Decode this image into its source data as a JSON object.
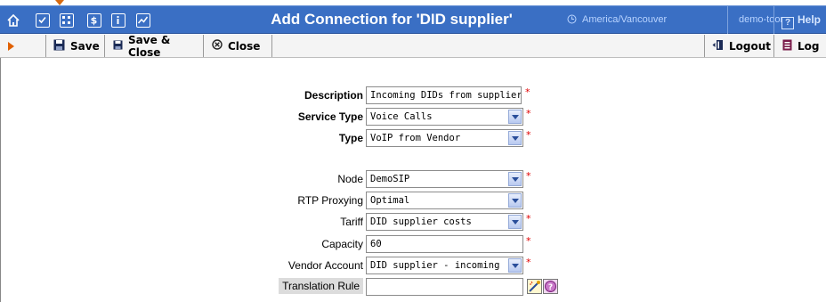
{
  "header": {
    "title": "Add Connection for 'DID supplier'",
    "timezone": "America/Vancouver",
    "user": "demo-toor",
    "help_label": "Help",
    "help_icon_glyph": "?"
  },
  "toolbar": {
    "save_label": "Save",
    "save_close_label": "Save & Close",
    "close_label": "Close",
    "logout_label": "Logout",
    "log_label": "Log"
  },
  "form": {
    "description": {
      "label": "Description",
      "value": "Incoming DIDs from supplier"
    },
    "service_type": {
      "label": "Service Type",
      "value": "Voice Calls"
    },
    "type": {
      "label": "Type",
      "value": "VoIP from Vendor"
    },
    "node": {
      "label": "Node",
      "value": "DemoSIP"
    },
    "rtp_proxying": {
      "label": "RTP Proxying",
      "value": "Optimal"
    },
    "tariff": {
      "label": "Tariff",
      "value": "DID supplier costs"
    },
    "capacity": {
      "label": "Capacity",
      "value": "60"
    },
    "vendor_account": {
      "label": "Vendor Account",
      "value": "DID supplier - incoming"
    },
    "translation_rule": {
      "label": "Translation Rule",
      "value": ""
    },
    "required_mark": "*"
  },
  "colors": {
    "header_bg": "#3a6fc4",
    "accent_orange": "#e06000",
    "required_red": "#e00000"
  }
}
